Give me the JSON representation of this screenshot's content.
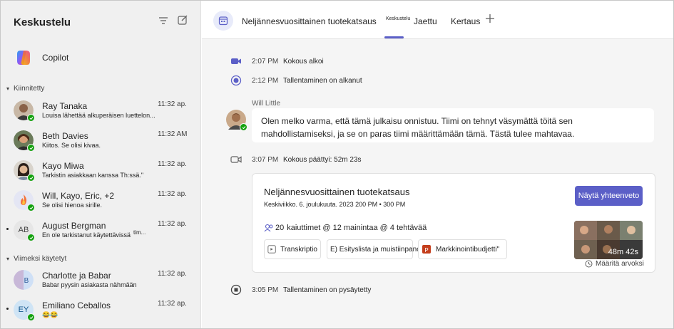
{
  "sidebar": {
    "title": "Keskustelu",
    "copilot_label": "Copilot",
    "pinned_label": "Kiinnitetty",
    "recent_label": "Viimeksi käytetyt",
    "chats": [
      {
        "name": "Ray Tanaka",
        "time": "11:32 ap.",
        "preview": "Louisa lähettää alkuperäisen luettelon..."
      },
      {
        "name": "Beth Davies",
        "time": "11:32 AM",
        "preview": "Kiitos. Se olisi kivaa."
      },
      {
        "name": "Kayo Miwa",
        "time": "11:32 ap.",
        "preview": "Tarkistin asiakkaan kanssa Th:ssä.\""
      },
      {
        "name": "Will, Kayo, Eric, +2",
        "time": "11:32 ap.",
        "preview": "Se olisi hienoa sirille."
      },
      {
        "name": "August Bergman",
        "time": "11:32 ap.",
        "preview": "En ole tarkistanut käytettävissä",
        "initials": "AB",
        "preview_extra": "tim..."
      },
      {
        "name": "Charlotte ja Babar",
        "time": "11:32 ap.",
        "preview": "Babar pyysin asiakasta nähmään"
      },
      {
        "name": "Emiliano Ceballos",
        "time": "11:32 ap.",
        "preview": "😂😂",
        "initials": "EY"
      }
    ]
  },
  "topbar": {
    "meeting_title": "Neljännesvuosittainen tuotekatsaus",
    "tab_small": "Keskustelu",
    "tabs": [
      "Jaettu",
      "Kertaus"
    ]
  },
  "events": [
    {
      "time": "2:07 PM",
      "text": "Kokous alkoi"
    },
    {
      "time": "2:12 PM",
      "text": "Tallentaminen on alkanut"
    },
    {
      "time": "3:07 PM",
      "text": "Kokous päättyi: 52m 23s"
    },
    {
      "time": "3:05 PM",
      "text": "Tallentaminen on pysäytetty"
    }
  ],
  "message": {
    "author": "Will Little",
    "text": "Olen melko varma, että tämä julkaisu onnistuu. Tiimi on tehnyt väsymättä töitä sen mahdollistamiseksi, ja se on paras tiimi määrittämään tämä. Tästä tulee mahtavaa."
  },
  "recap_card": {
    "title": "Neljännesvuosittainen tuotekatsaus",
    "subtitle": "Keskiviikko. 6. joulukuuta. 2023 200 PM • 300 PM",
    "button": "Näytä yhteenveto",
    "stats_count": "20",
    "stats_text": "kaiuttimet @ 12 mainintaa @ 4 tehtävää",
    "chips": [
      "Transkriptio",
      "E) Esityslista ja muistiinpanot",
      "Markkinointibudjetti\""
    ],
    "duration": "48m 42s",
    "footer": "Määritä arvoksi"
  },
  "colors": {
    "accent": "#5b5fc7",
    "presence": "#13a10e"
  }
}
